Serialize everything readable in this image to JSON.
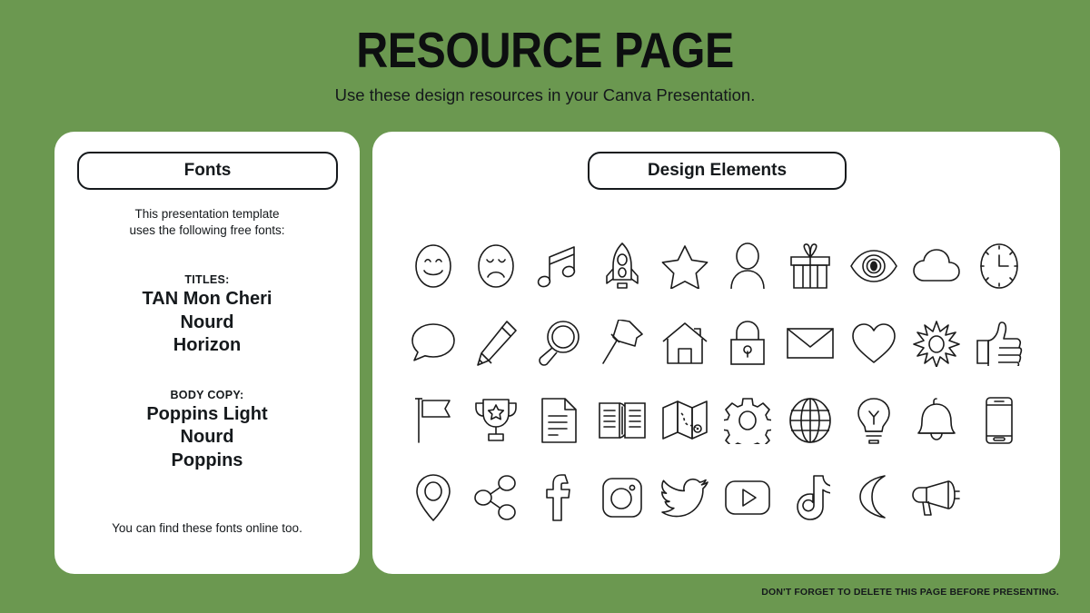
{
  "theme": {
    "background_color": "#6b9850",
    "card_color": "#ffffff",
    "ink_color": "#15191c"
  },
  "header": {
    "title": "RESOURCE PAGE",
    "subtitle": "Use these design resources in your Canva Presentation."
  },
  "fonts_card": {
    "pill_label": "Fonts",
    "intro_line_1": "This presentation template",
    "intro_line_2": "uses the following free fonts:",
    "titles_label": "TITLES:",
    "titles_fonts": [
      "TAN Mon Cheri",
      "Nourd",
      "Horizon"
    ],
    "body_label": "BODY COPY:",
    "body_fonts": [
      "Poppins Light",
      "Nourd",
      "Poppins"
    ],
    "footnote": "You can find these fonts online too."
  },
  "elements_card": {
    "pill_label": "Design Elements",
    "icons": [
      "smiley-face-icon",
      "sad-face-icon",
      "music-note-icon",
      "rocket-icon",
      "star-icon",
      "person-icon",
      "gift-icon",
      "eye-icon",
      "cloud-icon",
      "clock-icon",
      "speech-bubble-icon",
      "pencil-icon",
      "magnifier-icon",
      "pushpin-icon",
      "house-icon",
      "lock-icon",
      "envelope-icon",
      "heart-icon",
      "sun-icon",
      "thumbs-up-icon",
      "flag-icon",
      "trophy-icon",
      "document-icon",
      "open-book-icon",
      "map-icon",
      "gear-icon",
      "globe-icon",
      "lightbulb-icon",
      "bell-icon",
      "phone-icon",
      "location-pin-icon",
      "share-icon",
      "facebook-icon",
      "instagram-icon",
      "twitter-icon",
      "youtube-icon",
      "tiktok-icon",
      "moon-icon",
      "megaphone-icon"
    ]
  },
  "footer": {
    "note": "DON'T FORGET TO DELETE THIS PAGE BEFORE PRESENTING."
  }
}
